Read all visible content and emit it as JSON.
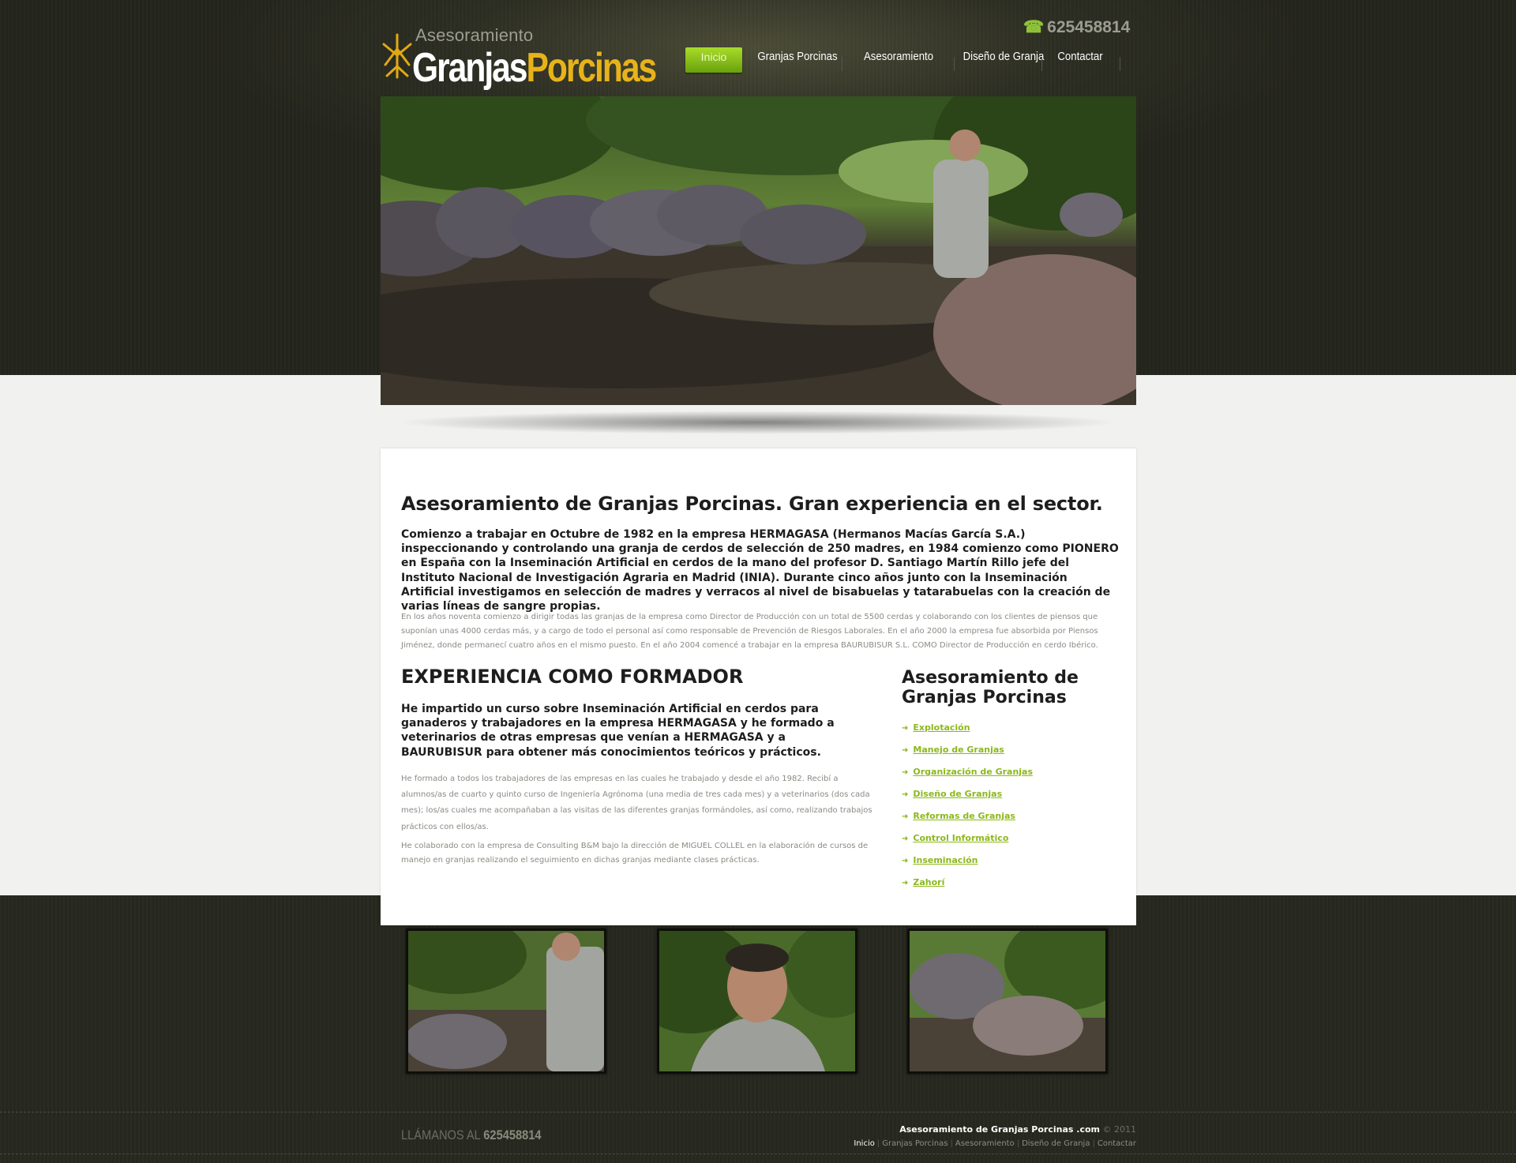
{
  "logo": {
    "line1": "Asesoramiento",
    "word1": "Granjas",
    "word2": "Porcinas"
  },
  "header": {
    "phone": "625458814"
  },
  "nav": {
    "items": [
      {
        "label": "Inicio",
        "active": true
      },
      {
        "label": "Granjas Porcinas",
        "active": false
      },
      {
        "label": "Asesoramiento",
        "active": false
      },
      {
        "label": "Diseño de Granja",
        "active": false
      },
      {
        "label": "Contactar",
        "active": false
      }
    ]
  },
  "content": {
    "title": "Asesoramiento de Granjas Porcinas. Gran experiencia en el sector.",
    "intro_bold": "Comienzo a trabajar en Octubre de 1982 en la empresa HERMAGASA (Hermanos Macías García S.A.) inspeccionando y controlando una granja de cerdos de selección de 250 madres, en 1984 comienzo como PIONERO en España con la Inseminación Artificial en cerdos de la mano del profesor D. Santiago Martín Rillo jefe del Instituto Nacional de Investigación Agraria en Madrid (INIA). Durante cinco años junto con la Inseminación Artificial investigamos en selección de madres y verracos al nivel de bisabuelas y tatarabuelas con la creación de varias líneas de sangre propias.",
    "intro_small": "En los años noventa comienzo a dirigir todas las granjas de la empresa como Director de Producción con un total de 5500 cerdas y colaborando con los clientes de piensos que suponían unas 4000 cerdas más, y a cargo de todo el personal así como responsable de Prevención de Riesgos Laborales. En el año 2000 la empresa fue absorbida por Piensos Jiménez, donde permanecí cuatro años en el mismo puesto. En el año 2004 comencé a trabajar en la empresa BAURUBISUR S.L. COMO Director de Producción en cerdo Ibérico.",
    "section_title": "EXPERIENCIA COMO FORMADOR",
    "formador_bold": "He impartido un curso sobre Inseminación Artificial en cerdos para ganaderos y trabajadores en la empresa HERMAGASA y he formado a veterinarios de otras empresas que venían a HERMAGASA y a BAURUBISUR para obtener más conocimientos teóricos y prácticos.",
    "formador_small_1": "He formado a todos los trabajadores de las empresas en las cuales he trabajado y desde el año 1982. Recibí a alumnos/as de cuarto y quinto curso de Ingeniería Agrónoma (una media de tres cada mes) y a veterinarios (dos cada mes); los/as cuales me acompañaban a las visitas de las diferentes granjas formándoles, así como, realizando trabajos prácticos con ellos/as.",
    "formador_small_2": "He colaborado con la empresa de Consulting B&M bajo la dirección de MIGUEL COLLEL en la elaboración de cursos de manejo en granjas realizando el seguimiento en dichas granjas mediante clases prácticas."
  },
  "sidebar": {
    "title": "Asesoramiento de Granjas Porcinas",
    "links": [
      "Explotación",
      "Manejo de Granjas",
      "Organización de Granjas",
      "Diseño de Granjas",
      "Reformas de Granjas",
      "Control Informático",
      "Inseminación",
      "Zahorí"
    ]
  },
  "footer": {
    "call_label": "LLÁMANOS AL",
    "call_phone": "625458814",
    "brand": "Asesoramiento de Granjas Porcinas .com",
    "copyright": "© 2011",
    "links": [
      "Inicio",
      "Granjas Porcinas",
      "Asesoramiento",
      "Diseño de Granja",
      "Contactar"
    ]
  },
  "colors": {
    "accent_green": "#8cb81c",
    "logo_gold": "#e7b319",
    "dark_bg": "#23241c"
  }
}
